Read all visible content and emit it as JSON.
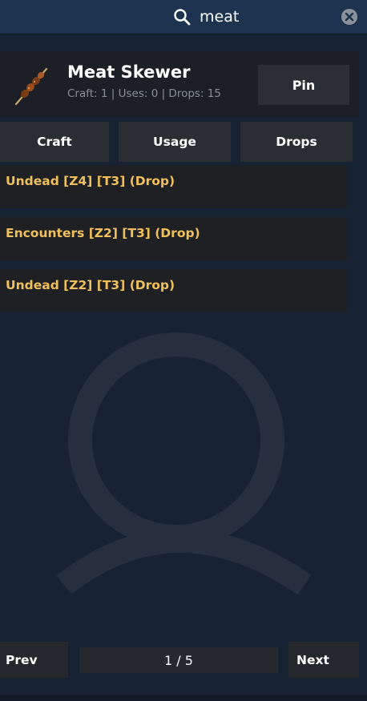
{
  "search": {
    "value": "meat",
    "icon": "search-icon",
    "clear_icon": "clear-icon"
  },
  "item": {
    "name": "Meat Skewer",
    "stats": "Craft: 1 | Uses: 0 | Drops: 15",
    "image": "meat-skewer-icon",
    "pin_label": "Pin"
  },
  "tabs": [
    {
      "label": "Craft"
    },
    {
      "label": "Usage"
    },
    {
      "label": "Drops"
    }
  ],
  "results": [
    {
      "label": "Undead [Z4] [T3] (Drop)"
    },
    {
      "label": "Encounters [Z2] [T3] (Drop)"
    },
    {
      "label": "Undead [Z2] [T3] (Drop)"
    }
  ],
  "pagination": {
    "prev_label": "Prev",
    "page": "1 / 5",
    "next_label": "Next"
  },
  "colors": {
    "background": "#172232",
    "topbar": "#1c3450",
    "card": "#1c1f25",
    "button": "#2a2d32",
    "result_text": "#f1c05a",
    "muted_text": "#8a8f96"
  }
}
